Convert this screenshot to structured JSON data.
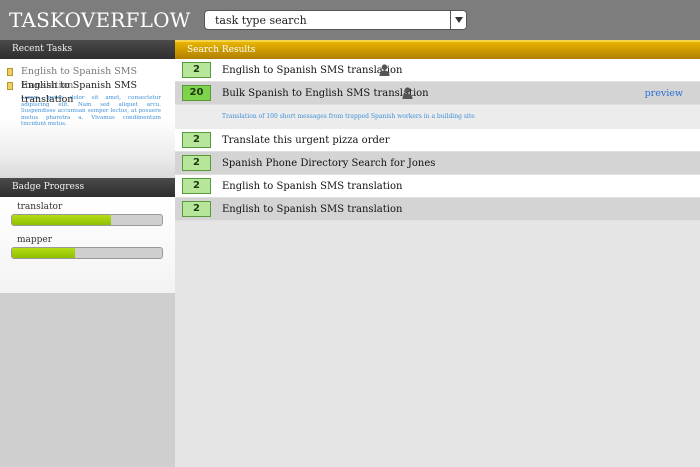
{
  "app": {
    "title": "TASKOVERFLOW"
  },
  "search": {
    "value": "task type search"
  },
  "recent_tasks": {
    "heading": "Recent Tasks",
    "items": [
      {
        "label": "English to Spanish SMS translation"
      },
      {
        "label": "English to Spanish SMS translation"
      }
    ],
    "description": "Lorem ipsum dolor sit amet, consectetur adipiscing elit. Nam sed aliquet arcu. Suspendisse accumsan semper lectus, at posuere metus pharetra a. Vivamus condimentum tincidunt metus."
  },
  "badge_progress": {
    "heading": "Badge Progress",
    "items": [
      {
        "label": "translator",
        "progress": 0.66
      },
      {
        "label": "mapper",
        "progress": 0.42
      }
    ]
  },
  "search_results": {
    "heading": "Search Results",
    "rows": [
      {
        "count": "2",
        "title": "English to Spanish SMS translation",
        "has_person_icon": true
      },
      {
        "count": "20",
        "title": "Bulk Spanish to English SMS translation",
        "has_person_icon": true,
        "preview": "preview",
        "detail": "Translation of 100 short messages from trapped Spanish workers in a building site"
      },
      {
        "count": "2",
        "title": "Translate this urgent pizza order"
      },
      {
        "count": "2",
        "title": "Spanish Phone Directory Search for Jones"
      },
      {
        "count": "2",
        "title": "English to Spanish SMS translation"
      },
      {
        "count": "2",
        "title": "English to Spanish SMS translation"
      }
    ]
  },
  "colors": {
    "header": "#7d7d7d",
    "results_bar": "#d9a300",
    "progress_fill": "#9ccc0a",
    "badge_green": "#b6e69a"
  }
}
